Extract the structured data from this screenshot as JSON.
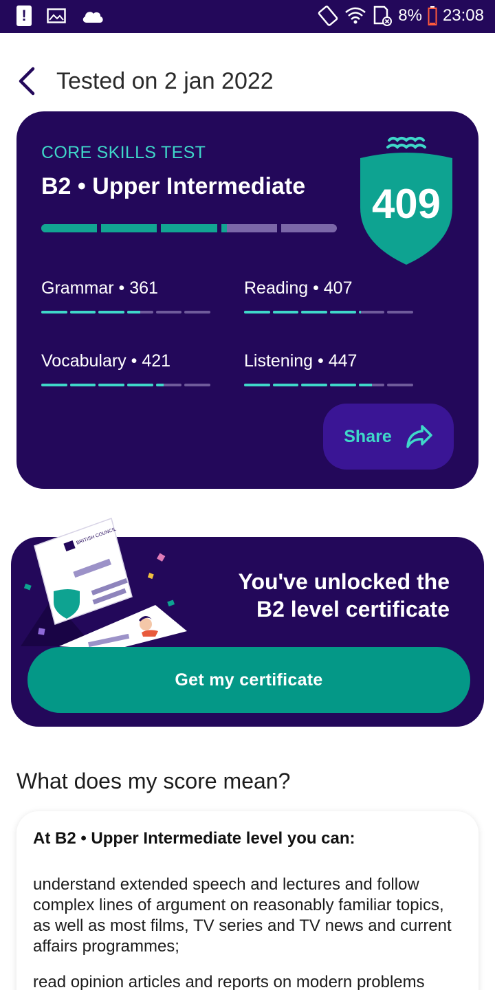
{
  "status_bar": {
    "battery": "8%",
    "time": "23:08",
    "icons": [
      "alert-icon",
      "image-icon",
      "cloud-icon",
      "rotate-icon",
      "wifi-icon",
      "sd-card-icon",
      "battery-icon"
    ]
  },
  "header": {
    "title": "Tested on 2 jan 2022"
  },
  "score_card": {
    "kicker": "CORE SKILLS TEST",
    "level": "B2 • Upper Intermediate",
    "score": "409",
    "progress_segments": [
      1,
      1,
      1,
      0.1,
      0
    ],
    "skills": [
      {
        "label": "Grammar • 361",
        "segments": [
          1,
          1,
          1,
          0.5,
          0,
          0
        ]
      },
      {
        "label": "Reading • 407",
        "segments": [
          1,
          1,
          1,
          1,
          0.1,
          0
        ]
      },
      {
        "label": "Vocabulary • 421",
        "segments": [
          1,
          1,
          1,
          1,
          0.3,
          0
        ]
      },
      {
        "label": "Listening • 447",
        "segments": [
          1,
          1,
          1,
          1,
          0.5,
          0
        ]
      }
    ],
    "share_label": "Share"
  },
  "certificate": {
    "title_line1": "You've unlocked the",
    "title_line2": "B2 level certificate",
    "button_label": "Get my certificate",
    "illustration_text": "BRITISH COUNCIL"
  },
  "meaning": {
    "heading": "What does my score mean?",
    "card_title": "At B2 • Upper Intermediate level you can:",
    "items": [
      "understand extended speech and lectures and follow complex lines of argument on reasonably familiar topics, as well as most films, TV series and TV news and current affairs programmes;",
      "read opinion articles and reports on modern problems"
    ]
  },
  "colors": {
    "brand_dark": "#23085a",
    "accent_teal": "#3fd8c9",
    "button_teal": "#049887",
    "share_bg": "#3a1595"
  }
}
